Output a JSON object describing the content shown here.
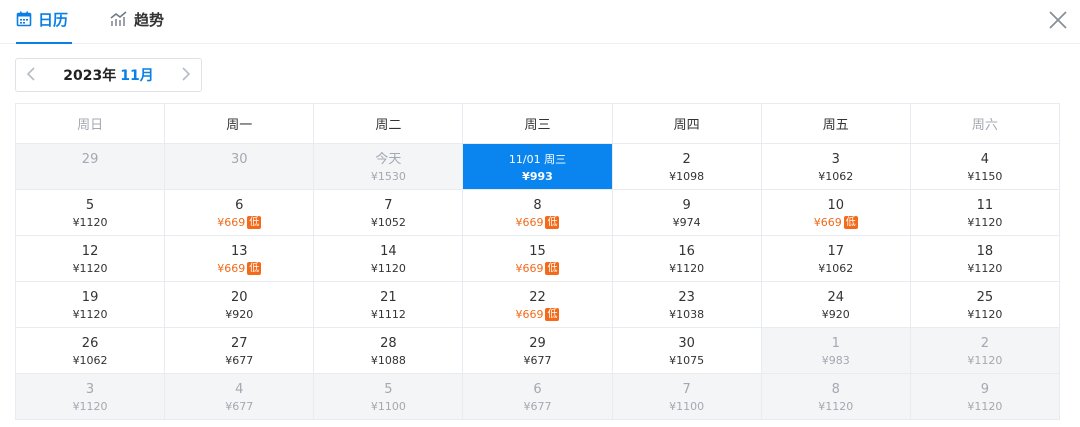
{
  "tabs": [
    {
      "label": "日历",
      "icon": "calendar-icon",
      "active": true
    },
    {
      "label": "趋势",
      "icon": "trend-icon",
      "active": false
    }
  ],
  "colors": {
    "accent": "#0a7fe6",
    "low_price": "#f26a1a",
    "muted": "#a3a9b1"
  },
  "month_nav": {
    "prev_icon": "chevron-left-icon",
    "year": "2023年",
    "month": "11月",
    "next_icon": "chevron-right-icon"
  },
  "weekdays": [
    "周日",
    "周一",
    "周二",
    "周三",
    "周四",
    "周五",
    "周六"
  ],
  "weeks": [
    [
      {
        "day": "29",
        "price": "",
        "state": "dim"
      },
      {
        "day": "30",
        "price": "",
        "state": "dim"
      },
      {
        "day": "今天",
        "price": "¥1530",
        "state": "dim"
      },
      {
        "day": "11/01 周三",
        "price": "¥993",
        "state": "selected"
      },
      {
        "day": "2",
        "price": "¥1098"
      },
      {
        "day": "3",
        "price": "¥1062"
      },
      {
        "day": "4",
        "price": "¥1150"
      }
    ],
    [
      {
        "day": "5",
        "price": "¥1120"
      },
      {
        "day": "6",
        "price": "¥669",
        "badge": "低"
      },
      {
        "day": "7",
        "price": "¥1052"
      },
      {
        "day": "8",
        "price": "¥669",
        "badge": "低"
      },
      {
        "day": "9",
        "price": "¥974"
      },
      {
        "day": "10",
        "price": "¥669",
        "badge": "低"
      },
      {
        "day": "11",
        "price": "¥1120"
      }
    ],
    [
      {
        "day": "12",
        "price": "¥1120"
      },
      {
        "day": "13",
        "price": "¥669",
        "badge": "低"
      },
      {
        "day": "14",
        "price": "¥1120"
      },
      {
        "day": "15",
        "price": "¥669",
        "badge": "低"
      },
      {
        "day": "16",
        "price": "¥1120"
      },
      {
        "day": "17",
        "price": "¥1062"
      },
      {
        "day": "18",
        "price": "¥1120"
      }
    ],
    [
      {
        "day": "19",
        "price": "¥1120"
      },
      {
        "day": "20",
        "price": "¥920"
      },
      {
        "day": "21",
        "price": "¥1112"
      },
      {
        "day": "22",
        "price": "¥669",
        "badge": "低"
      },
      {
        "day": "23",
        "price": "¥1038"
      },
      {
        "day": "24",
        "price": "¥920"
      },
      {
        "day": "25",
        "price": "¥1120"
      }
    ],
    [
      {
        "day": "26",
        "price": "¥1062"
      },
      {
        "day": "27",
        "price": "¥677"
      },
      {
        "day": "28",
        "price": "¥1088"
      },
      {
        "day": "29",
        "price": "¥677"
      },
      {
        "day": "30",
        "price": "¥1075"
      },
      {
        "day": "1",
        "price": "¥983",
        "state": "dim"
      },
      {
        "day": "2",
        "price": "¥1120",
        "state": "dim"
      }
    ],
    [
      {
        "day": "3",
        "price": "¥1120",
        "state": "dim"
      },
      {
        "day": "4",
        "price": "¥677",
        "state": "dim"
      },
      {
        "day": "5",
        "price": "¥1100",
        "state": "dim"
      },
      {
        "day": "6",
        "price": "¥677",
        "state": "dim"
      },
      {
        "day": "7",
        "price": "¥1100",
        "state": "dim"
      },
      {
        "day": "8",
        "price": "¥1120",
        "state": "dim"
      },
      {
        "day": "9",
        "price": "¥1120",
        "state": "dim"
      }
    ]
  ]
}
